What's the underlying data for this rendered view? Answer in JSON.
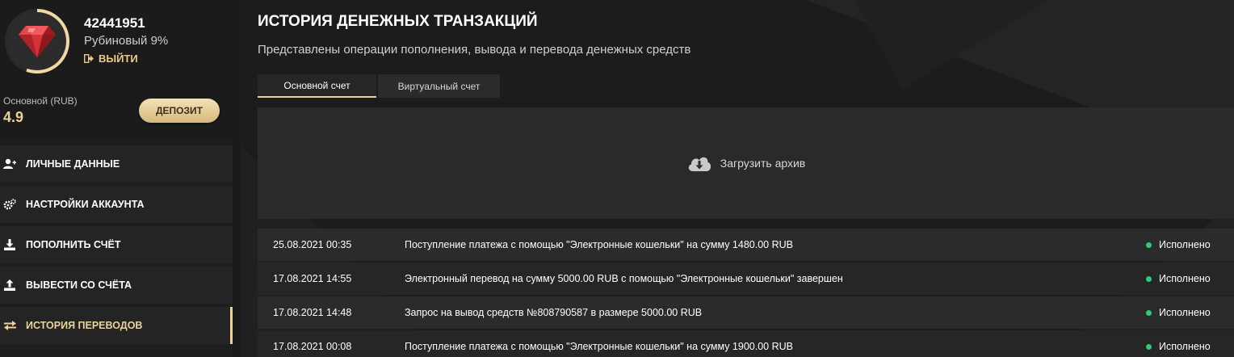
{
  "profile": {
    "user_id": "42441951",
    "level": "Рубиновый 9%",
    "logout_label": "ВЫЙТИ",
    "balance_label": "Основной (RUB)",
    "balance_value": "4.9",
    "deposit_label": "ДЕПОЗИТ",
    "avatar_icon": "ruby-gem-icon"
  },
  "nav": {
    "items": [
      {
        "label": "ЛИЧНЫЕ ДАННЫЕ",
        "icon": "add-user-icon"
      },
      {
        "label": "НАСТРОЙКИ АККАУНТА",
        "icon": "gears-icon"
      },
      {
        "label": "ПОПОЛНИТЬ СЧЁТ",
        "icon": "download-icon"
      },
      {
        "label": "ВЫВЕСТИ СО СЧЁТА",
        "icon": "upload-icon"
      },
      {
        "label": "ИСТОРИЯ ПЕРЕВОДОВ",
        "icon": "transfer-arrows-icon",
        "active": true
      }
    ]
  },
  "main": {
    "title": "ИСТОРИЯ ДЕНЕЖНЫХ ТРАНЗАКЦИЙ",
    "subtitle": "Представлены операции пополнения, вывода и перевода денежных средств",
    "tabs": [
      {
        "label": "Основной счет",
        "active": true
      },
      {
        "label": "Виртуальный счет",
        "active": false
      }
    ],
    "archive_label": "Загрузить архив",
    "transactions": [
      {
        "date": "25.08.2021 00:35",
        "description": "Поступление платежа с помощью \"Электронные кошельки\" на сумму 1480.00 RUB",
        "status": "Исполнено"
      },
      {
        "date": "17.08.2021 14:55",
        "description": "Электронный перевод на сумму 5000.00 RUB с помощью \"Электронные кошельки\" завершен",
        "status": "Исполнено"
      },
      {
        "date": "17.08.2021 14:48",
        "description": "Запрос на вывод средств №808790587 в размере 5000.00 RUB",
        "status": "Исполнено"
      },
      {
        "date": "17.08.2021 00:08",
        "description": "Поступление платежа с помощью \"Электронные кошельки\" на сумму 1900.00 RUB",
        "status": "Исполнено"
      }
    ]
  },
  "colors": {
    "accent": "#ecd29a",
    "status_ok": "#2ecc71",
    "background": "#1c1c1c"
  }
}
